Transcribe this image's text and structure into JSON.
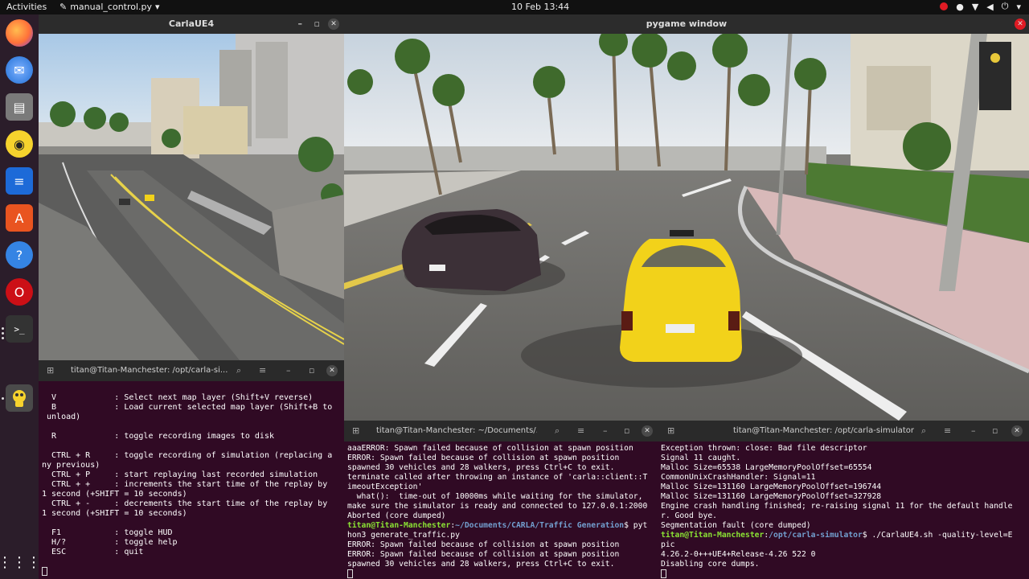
{
  "topbar": {
    "activities": "Activities",
    "app_name": "manual_control.py",
    "clock": "10 Feb  13:44"
  },
  "dock": {
    "items": [
      "firefox-icon",
      "thunderbird-icon",
      "files-icon",
      "rhythmbox-icon",
      "libreoffice-writer-icon",
      "ubuntu-software-icon",
      "help-icon",
      "opera-icon",
      "terminal-icon",
      "carla-icon",
      "show-apps-icon"
    ]
  },
  "carla_window": {
    "title": "CarlaUE4"
  },
  "pygame_window": {
    "title": "pygame window"
  },
  "terminal_left": {
    "title": "titan@Titan-Manchester: /opt/carla-si...",
    "lines": [
      "",
      "  V            : Select next map layer (Shift+V reverse)",
      "  B            : Load current selected map layer (Shift+B to",
      " unload)",
      "",
      "  R            : toggle recording images to disk",
      "",
      "  CTRL + R     : toggle recording of simulation (replacing a",
      "ny previous)",
      "  CTRL + P     : start replaying last recorded simulation",
      "  CTRL + +     : increments the start time of the replay by",
      "1 second (+SHIFT = 10 seconds)",
      "  CTRL + -     : decrements the start time of the replay by",
      "1 second (+SHIFT = 10 seconds)",
      "",
      "  F1           : toggle HUD",
      "  H/?          : toggle help",
      "  ESC          : quit"
    ]
  },
  "terminal_middle": {
    "title": "titan@Titan-Manchester: ~/Documents/...",
    "lines_before": [
      "aaaERROR: Spawn failed because of collision at spawn position",
      "ERROR: Spawn failed because of collision at spawn position",
      "spawned 30 vehicles and 28 walkers, press Ctrl+C to exit.",
      "terminate called after throwing an instance of 'carla::client::T",
      "imeoutException'",
      "  what():  time-out of 10000ms while waiting for the simulator,",
      "make sure the simulator is ready and connected to 127.0.0.1:2000",
      "Aborted (core dumped)"
    ],
    "prompt_user": "titan@Titan-Manchester",
    "prompt_path": "~/Documents/CARLA/Traffic Generation",
    "prompt_cmd": "$ pyt",
    "cmd_wrap": "hon3 generate_traffic.py",
    "lines_after": [
      "ERROR: Spawn failed because of collision at spawn position",
      "ERROR: Spawn failed because of collision at spawn position",
      "spawned 30 vehicles and 28 walkers, press Ctrl+C to exit."
    ]
  },
  "terminal_right": {
    "title": "titan@Titan-Manchester: /opt/carla-simulator",
    "lines_before": [
      "Exception thrown: close: Bad file descriptor",
      "Signal 11 caught.",
      "Malloc Size=65538 LargeMemoryPoolOffset=65554",
      "CommonUnixCrashHandler: Signal=11",
      "Malloc Size=131160 LargeMemoryPoolOffset=196744",
      "Malloc Size=131160 LargeMemoryPoolOffset=327928",
      "Engine crash handling finished; re-raising signal 11 for the default handle",
      "r. Good bye.",
      "Segmentation fault (core dumped)"
    ],
    "prompt_user": "titan@Titan-Manchester",
    "prompt_path": "/opt/carla-simulator",
    "prompt_cmd": "$ ./CarlaUE4.sh -quality-level=E",
    "cmd_wrap": "pic",
    "lines_after": [
      "4.26.2-0+++UE4+Release-4.26 522 0",
      "Disabling core dumps."
    ]
  },
  "colors": {
    "terminal_bg": "#300a24",
    "prompt_green": "#8ae234",
    "path_blue": "#729fcf",
    "taxi_yellow": "#f2d21a"
  }
}
